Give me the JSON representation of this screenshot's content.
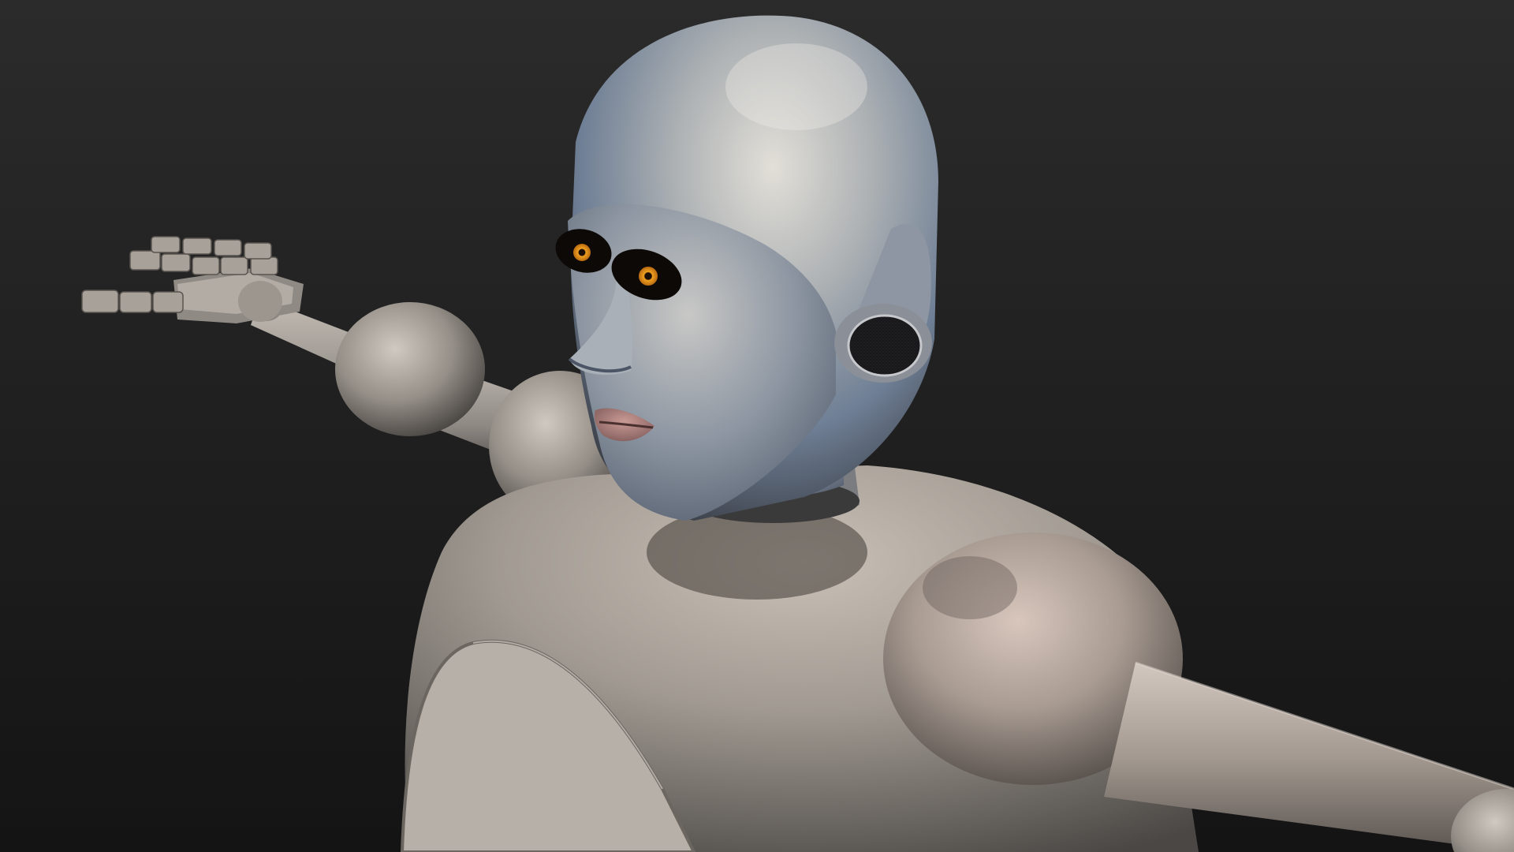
{
  "scene": {
    "subject": "robot-figure",
    "colors": {
      "background_top": "#2b2b2b",
      "background_bottom": "#141414",
      "metal_light": "#d6d3cc",
      "metal_mid": "#9c9890",
      "metal_dark": "#4a4744",
      "metal_blue": "#6f7f95",
      "warm_tint": "#b9968a",
      "eye_iris": "#e08a16",
      "eye_socket": "#0c0906",
      "lips": "#b08582",
      "speaker_mesh": "#2a2a2c"
    }
  }
}
